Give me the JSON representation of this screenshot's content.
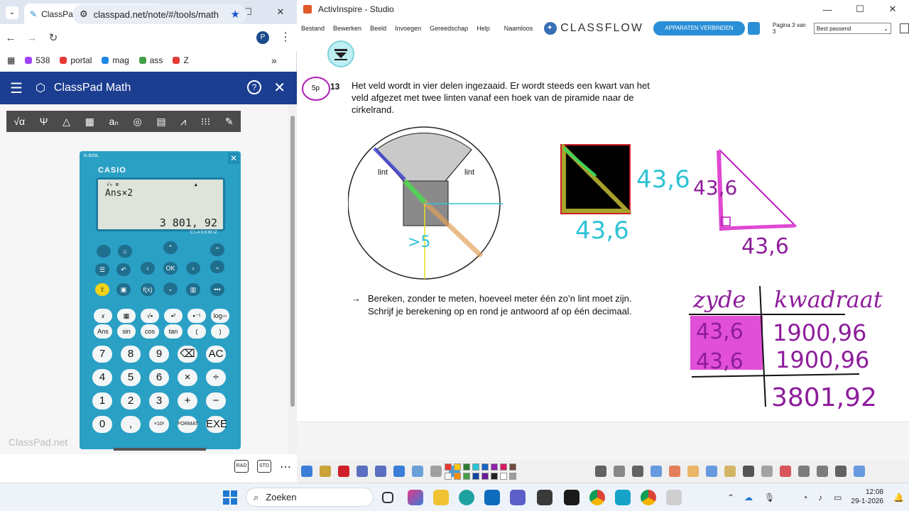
{
  "chrome": {
    "tab_title": "ClassPad.net",
    "url": "classpad.net/note/#/tools/math",
    "profile_letter": "P",
    "bookmarks": [
      {
        "label": "538",
        "color": "#a142f4"
      },
      {
        "label": "portal",
        "color": "#e53935"
      },
      {
        "label": "mag",
        "color": "#1e88e5"
      },
      {
        "label": "ass",
        "color": "#43a047"
      },
      {
        "label": "Z",
        "color": "#e53935"
      }
    ],
    "bookmarks_more": "»"
  },
  "classpad": {
    "title": "ClassPad Math",
    "watermark": "ClassPad.net",
    "tools": [
      "√α",
      "Ψ",
      "△",
      "▦",
      "aₙ",
      "◎",
      "▤",
      "⩘",
      "⁝⁝⁝",
      "✎"
    ],
    "footer_buttons": [
      "RAD",
      "STD"
    ],
    "footer_more": "⋯"
  },
  "calculator": {
    "model": "fx-82NL",
    "brand": "CASIO",
    "series": "CLASSWIZ",
    "indicator": "√▫ ⊠",
    "indicator_right": "▲",
    "expression": "Ans×2",
    "result": "3 801, 92",
    "fkeys_row1": [
      "𝑥",
      "▦",
      "√▪",
      "▪²",
      "▪⁻¹",
      "log▫▫"
    ],
    "fkeys_row2": [
      "Ans",
      "sin",
      "cos",
      "tan",
      "(",
      ")"
    ],
    "num_rows": [
      [
        "7",
        "8",
        "9",
        "⌫",
        "AC"
      ],
      [
        "4",
        "5",
        "6",
        "×",
        "÷"
      ],
      [
        "1",
        "2",
        "3",
        "+",
        "−"
      ],
      [
        "0",
        ",",
        "×10ˣ",
        "FORMAT",
        "EXE"
      ]
    ]
  },
  "activinspire": {
    "title": "ActivInspire - Studio",
    "menu": [
      "Bestand",
      "Bewerken",
      "Beeld",
      "Invoegen",
      "Gereedschap",
      "Help",
      "Naamloos"
    ],
    "classflow": "CLASSFLOW",
    "connect_button": "APPARATEN VERBINDEN",
    "page_info": "Pagina 3 van 3",
    "zoom": "Best passend",
    "question": {
      "points": "5p",
      "number": "13",
      "line1": "Het veld wordt in vier delen ingezaaid. Er wordt steeds een kwart van het",
      "line2": "veld afgezet met twee linten vanaf een hoek van de piramide naar de",
      "line3": "cirkelrand.",
      "label_lint_left": "lint",
      "label_lint_right": "lint",
      "task_arrow": "→",
      "task1": "Bereken, zonder te meten, hoeveel meter één zo’n lint moet zijn.",
      "task2": "Schrijf je berekening op en rond je antwoord af op één decimaal."
    },
    "handwriting": {
      "circle_annot": ">5",
      "square_side_right": "43,6",
      "square_side_bottom": "43,6",
      "triangle_side_left": "43,6",
      "triangle_side_bottom": "43,6",
      "table_header_left": "zyde",
      "table_header_right": "kwadraat",
      "row1_left": "43,6",
      "row1_right": "1900,96",
      "row2_left": "43,6",
      "row2_right": "1900,96",
      "sum": "3801,92"
    },
    "swatches": [
      "#e53935",
      "#f9c80e",
      "#2e7d32",
      "#26c6da",
      "#1565c0",
      "#8e24aa",
      "#d81b60",
      "#6d4c41",
      "#f5f5f5",
      "#fb8c00",
      "#43a047",
      "#0d47a1",
      "#6a1b9a",
      "#212121",
      "#ffffff",
      "#9e9e9e"
    ]
  },
  "taskbar": {
    "search_placeholder": "Zoeken",
    "time": "12:08",
    "date": "29-1-2026"
  }
}
